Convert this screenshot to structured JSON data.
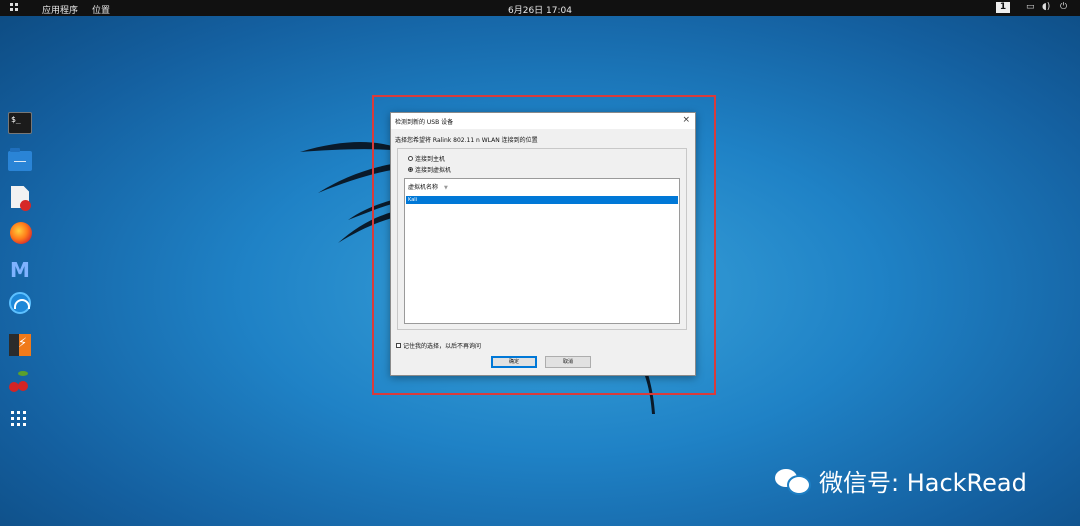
{
  "topbar": {
    "apps_label": "应用程序",
    "places_label": "位置",
    "clock": "6月26日 17:04",
    "workspace": "1",
    "icons": [
      "screen-icon",
      "volume-icon",
      "power-icon"
    ]
  },
  "dock": {
    "items": [
      "terminal-icon",
      "files-icon",
      "text-editor-icon",
      "firefox-icon",
      "metasploit-icon",
      "wireshark-icon",
      "burpsuite-icon",
      "cherrytree-icon",
      "show-apps-icon"
    ]
  },
  "dialog": {
    "title": "检测到新的 USB 设备",
    "close_glyph": "×",
    "prompt": "选择您希望将 Ralink 802.11 n WLAN 连接到的位置",
    "option_host": "连接到主机",
    "option_vm": "连接到虚拟机",
    "selected_option": "vm",
    "list_header": "虚拟机名称",
    "list_header_arrow": "▼",
    "vm_items": [
      "Kali"
    ],
    "remember_label": "记住我的选择，以后不再询问",
    "remember_checked": false,
    "ok_label": "确定",
    "cancel_label": "取消"
  },
  "watermark": {
    "text": "微信号: HackRead"
  },
  "colors": {
    "highlight": "#d93b3b",
    "selection": "#0078d7",
    "desktop": "#1f82c6"
  }
}
